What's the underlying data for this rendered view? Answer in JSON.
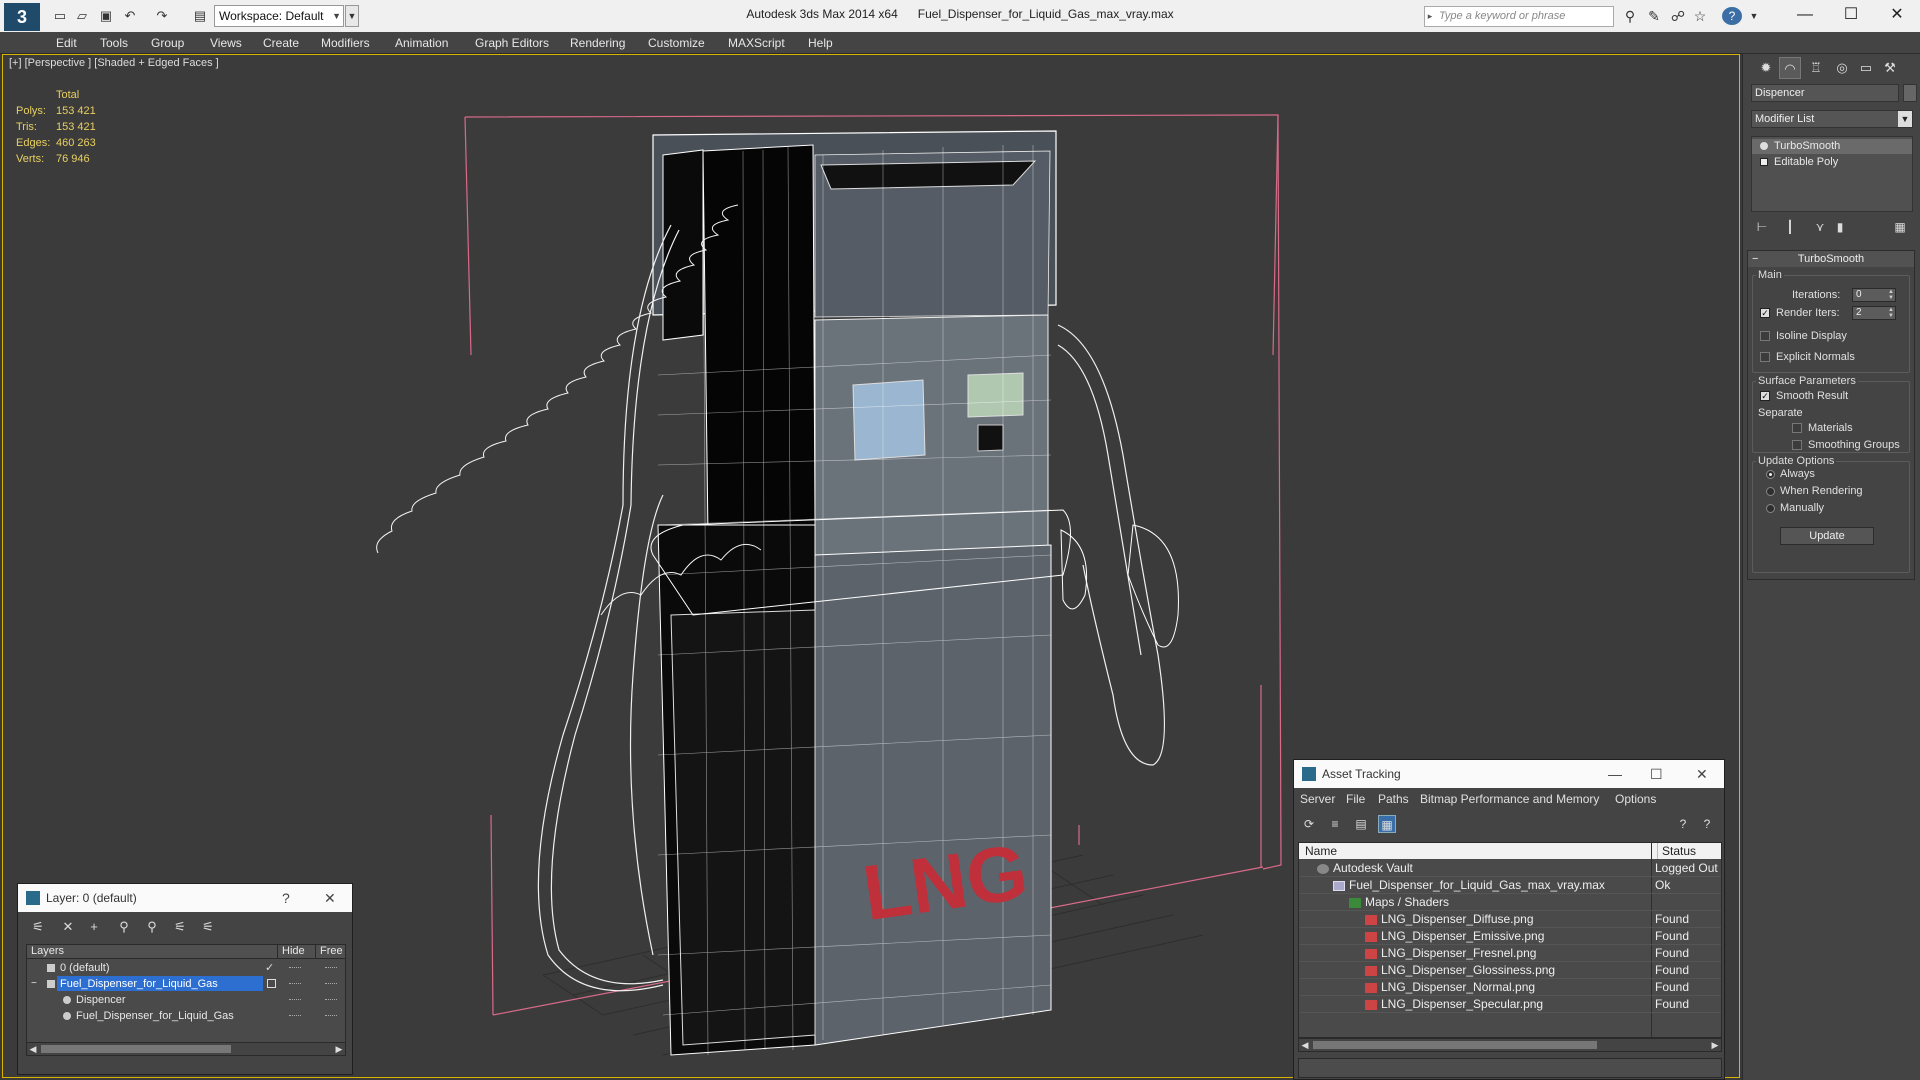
{
  "titlebar": {
    "workspace": "Workspace: Default",
    "app_title": "Autodesk 3ds Max  2014 x64",
    "file_title": "Fuel_Dispenser_for_Liquid_Gas_max_vray.max",
    "search_placeholder": "Type a keyword or phrase",
    "help": "?"
  },
  "menu": [
    "Edit",
    "Tools",
    "Group",
    "Views",
    "Create",
    "Modifiers",
    "Animation",
    "Graph Editors",
    "Rendering",
    "Customize",
    "MAXScript",
    "Help"
  ],
  "viewport": {
    "label": "[+] [Perspective ] [Shaded + Edged Faces ]",
    "model_text": "LNG",
    "stats": {
      "header": "Total",
      "rows": [
        {
          "label": "Polys:",
          "value": "153 421"
        },
        {
          "label": "Tris:",
          "value": "153 421"
        },
        {
          "label": "Edges:",
          "value": "460 263"
        },
        {
          "label": "Verts:",
          "value": "76 946"
        }
      ]
    }
  },
  "command_panel": {
    "object_name": "Dispencer",
    "modifier_list": "Modifier List",
    "stack": [
      "TurboSmooth",
      "Editable Poly"
    ],
    "rollout": {
      "title": "TurboSmooth",
      "main_label": "Main",
      "iterations_label": "Iterations:",
      "iterations_value": "0",
      "render_iters_label": "Render Iters:",
      "render_iters_value": "2",
      "render_iters_checked": true,
      "isoline": "Isoline Display",
      "explicit": "Explicit Normals",
      "surface_label": "Surface Parameters",
      "smooth_result": "Smooth Result",
      "separate": "Separate",
      "materials": "Materials",
      "smoothing_groups": "Smoothing Groups",
      "update_label": "Update Options",
      "always": "Always",
      "when_rendering": "When Rendering",
      "manually": "Manually",
      "update_button": "Update"
    }
  },
  "layer_window": {
    "title": "Layer: 0 (default)",
    "help": "?",
    "columns": {
      "layers": "Layers",
      "hide": "Hide",
      "freeze": "Free"
    },
    "rows": [
      {
        "name": "0 (default)",
        "selected": false,
        "indent": 1
      },
      {
        "name": "Fuel_Dispenser_for_Liquid_Gas",
        "selected": true,
        "indent": 1
      },
      {
        "name": "Dispencer",
        "selected": false,
        "indent": 2
      },
      {
        "name": "Fuel_Dispenser_for_Liquid_Gas",
        "selected": false,
        "indent": 2
      }
    ]
  },
  "asset_window": {
    "title": "Asset Tracking",
    "menu": [
      "Server",
      "File",
      "Paths",
      "Bitmap Performance and Memory",
      "Options"
    ],
    "columns": {
      "name": "Name",
      "status": "Status"
    },
    "rows": [
      {
        "name": "Autodesk Vault",
        "status": "Logged Out",
        "indent": 1,
        "icon": "vault-icon"
      },
      {
        "name": "Fuel_Dispenser_for_Liquid_Gas_max_vray.max",
        "status": "Ok",
        "indent": 2,
        "icon": "max-file-icon"
      },
      {
        "name": "Maps / Shaders",
        "status": "",
        "indent": 3,
        "icon": "maps-icon"
      },
      {
        "name": "LNG_Dispenser_Diffuse.png",
        "status": "Found",
        "indent": 4,
        "icon": "png-icon"
      },
      {
        "name": "LNG_Dispenser_Emissive.png",
        "status": "Found",
        "indent": 4,
        "icon": "png-icon"
      },
      {
        "name": "LNG_Dispenser_Fresnel.png",
        "status": "Found",
        "indent": 4,
        "icon": "png-icon"
      },
      {
        "name": "LNG_Dispenser_Glossiness.png",
        "status": "Found",
        "indent": 4,
        "icon": "png-icon"
      },
      {
        "name": "LNG_Dispenser_Normal.png",
        "status": "Found",
        "indent": 4,
        "icon": "png-icon"
      },
      {
        "name": "LNG_Dispenser_Specular.png",
        "status": "Found",
        "indent": 4,
        "icon": "png-icon"
      }
    ]
  },
  "colors": {
    "viewport_border": "#d8b400",
    "stats_text": "#e8d060",
    "selection": "#2c6fd1",
    "bbox": "#d86a8a",
    "lng_text": "#c0303a"
  }
}
